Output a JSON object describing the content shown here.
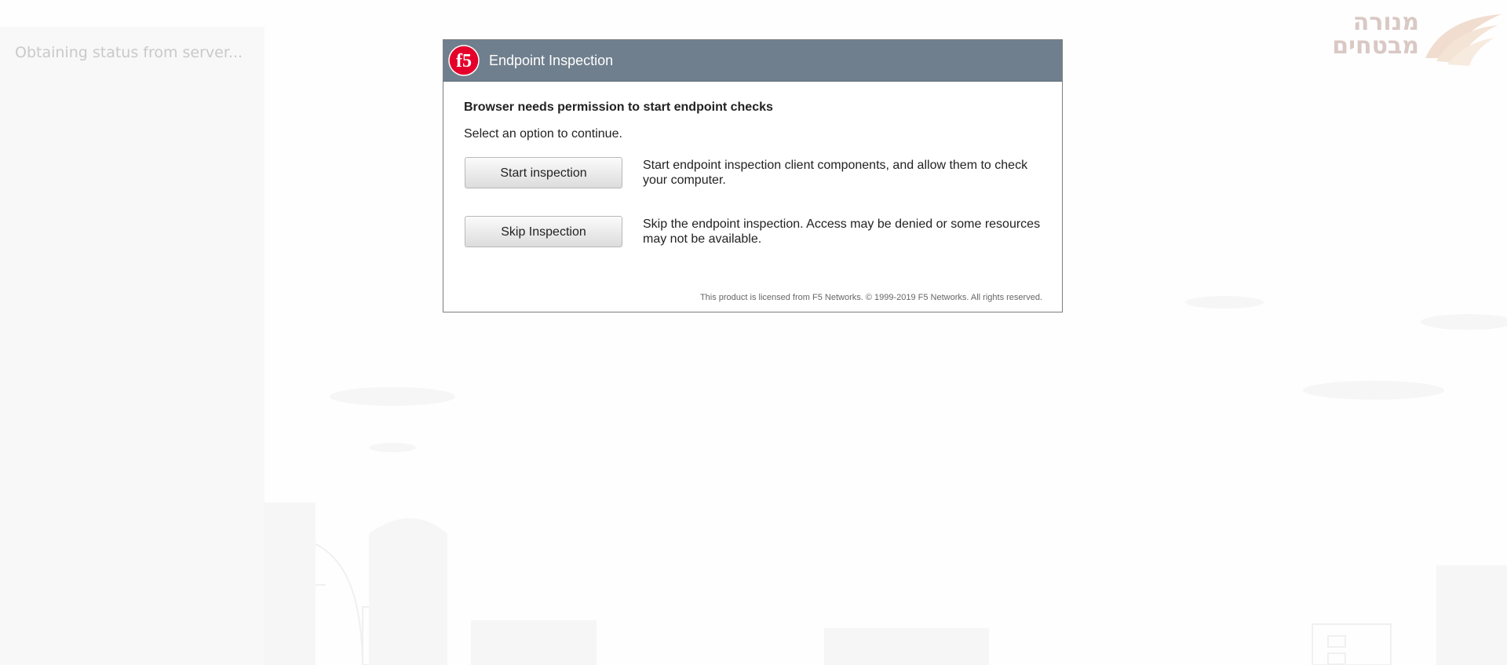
{
  "status": {
    "text": "Obtaining status from server..."
  },
  "brand": {
    "logo_line1": "מנורה",
    "logo_line2": "מבטחים",
    "logo_icon": "menora-flame-icon"
  },
  "dialog": {
    "logo_icon": "f5-logo-icon",
    "logo_text": "f5",
    "title": "Endpoint Inspection",
    "heading": "Browser needs permission to start endpoint checks",
    "subheading": "Select an option to continue.",
    "options": [
      {
        "button_label": "Start inspection",
        "description": "Start endpoint inspection client components, and allow them to check your computer."
      },
      {
        "button_label": "Skip Inspection",
        "description": "Skip the endpoint inspection. Access may be denied or some resources may not be available."
      }
    ],
    "footer": "This product is licensed from F5 Networks. © 1999-2019 F5 Networks. All rights reserved."
  },
  "colors": {
    "header_bg": "#707f8e",
    "logo_red": "#e4002b",
    "brand_tint": "#d9c8c4"
  }
}
